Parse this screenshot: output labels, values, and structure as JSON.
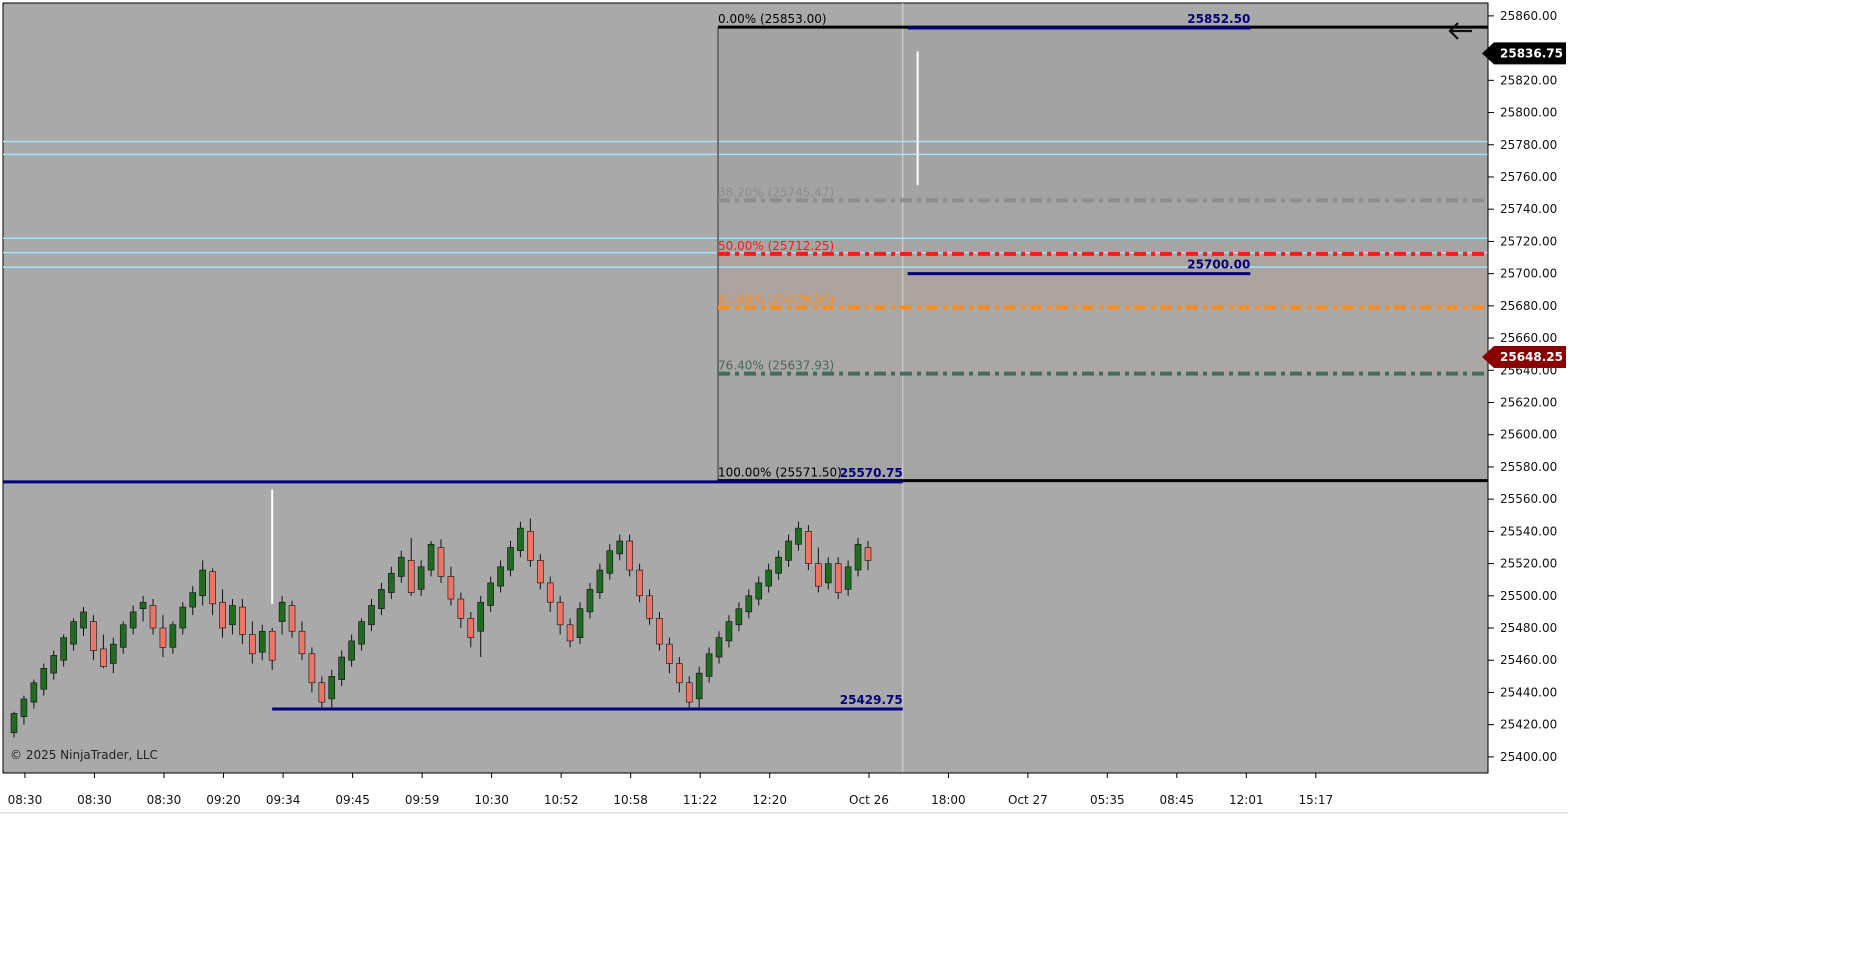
{
  "copyright": "© 2025 NinjaTrader, LLC",
  "colors": {
    "plot_bg": "#a9a9a9",
    "up": "#1f6b1f",
    "down": "#ee7466",
    "wick": "#111111",
    "navy": "#00007f",
    "fib_0": "#000000",
    "fib_382": "#8c8c8c",
    "fib_500": "#ff1a1a",
    "fib_618": "#ff8c1a",
    "fib_764": "#456a5e",
    "fib_100": "#000000",
    "zone_lines": "#9fe3ff",
    "last_price_bg": "#000000",
    "marker_price_bg": "#8b0000"
  },
  "chart_data": {
    "type": "candlestick",
    "y_axis": {
      "min": 25390,
      "max": 25868,
      "ticks": [
        25400,
        25420,
        25440,
        25460,
        25480,
        25500,
        25520,
        25540,
        25560,
        25580,
        25600,
        25620,
        25640,
        25660,
        25680,
        25700,
        25720,
        25740,
        25760,
        25780,
        25800,
        25820,
        25840,
        25860
      ],
      "tick_labels": [
        "25400.00",
        "25420.00",
        "25440.00",
        "25460.00",
        "25480.00",
        "25500.00",
        "25520.00",
        "25540.00",
        "25560.00",
        "25580.00",
        "25600.00",
        "25620.00",
        "25640.00",
        "25660.00",
        "25680.00",
        "25700.00",
        "25720.00",
        "25740.00",
        "25760.00",
        "25780.00",
        "25800.00",
        "25820.00",
        "25840.00",
        "25860.00"
      ]
    },
    "x_axis": {
      "labels": [
        "08:30",
        "08:30",
        "08:30",
        "09:20",
        "09:34",
        "09:45",
        "09:59",
        "10:30",
        "10:52",
        "10:58",
        "11:22",
        "12:20",
        "Oct 26",
        "18:00",
        "Oct 27",
        "05:35",
        "08:45",
        "12:01",
        "15:17"
      ],
      "label_index": [
        1,
        8,
        15,
        21,
        27,
        34,
        41,
        48,
        55,
        62,
        69,
        76,
        86,
        94,
        102,
        110,
        117,
        124,
        131
      ]
    },
    "price_markers": [
      {
        "label": "25836.75",
        "value": 25836.75,
        "role": "last"
      },
      {
        "label": "25648.25",
        "value": 25648.25,
        "role": "marker"
      }
    ],
    "fibonacci": {
      "start_index": 71,
      "end_index": 146,
      "levels": [
        {
          "label": "0.00% (25853.00)",
          "value": 25853.0,
          "color_key": "fib_0",
          "style": "solid"
        },
        {
          "label": "38.20% (25745.47)",
          "value": 25745.47,
          "color_key": "fib_382",
          "style": "dashdot"
        },
        {
          "label": "50.00% (25712.25)",
          "value": 25712.25,
          "color_key": "fib_500",
          "style": "dashdot"
        },
        {
          "label": "61.80% (25679.03)",
          "value": 25679.03,
          "color_key": "fib_618",
          "style": "dashdot"
        },
        {
          "label": "76.40% (25637.93)",
          "value": 25637.93,
          "color_key": "fib_764",
          "style": "dashdot"
        },
        {
          "label": "100.00% (25571.50)",
          "value": 25571.5,
          "color_key": "fib_100",
          "style": "solid"
        }
      ]
    },
    "swing_lines": [
      {
        "label": "25852.50",
        "value": 25852.5,
        "start_index": 90,
        "end_index": 124
      },
      {
        "label": "25700.00",
        "value": 25700.0,
        "start_index": 90,
        "end_index": 124
      },
      {
        "label": "25570.75",
        "value": 25570.75,
        "start_index": -1,
        "end_index": 89
      },
      {
        "label": "25429.75",
        "value": 25429.75,
        "start_index": 26,
        "end_index": 89
      }
    ],
    "zone_lines": [
      25782,
      25774,
      25722,
      25713,
      25704
    ],
    "candles": [
      {
        "o": 25415,
        "h": 25428,
        "l": 25412,
        "c": 25427
      },
      {
        "o": 25425,
        "h": 25438,
        "l": 25420,
        "c": 25436
      },
      {
        "o": 25434,
        "h": 25448,
        "l": 25430,
        "c": 25446
      },
      {
        "o": 25442,
        "h": 25458,
        "l": 25438,
        "c": 25455
      },
      {
        "o": 25452,
        "h": 25466,
        "l": 25448,
        "c": 25463
      },
      {
        "o": 25460,
        "h": 25476,
        "l": 25456,
        "c": 25474
      },
      {
        "o": 25470,
        "h": 25486,
        "l": 25466,
        "c": 25484
      },
      {
        "o": 25480,
        "h": 25493,
        "l": 25475,
        "c": 25490
      },
      {
        "o": 25484,
        "h": 25488,
        "l": 25460,
        "c": 25466
      },
      {
        "o": 25467,
        "h": 25476,
        "l": 25455,
        "c": 25456
      },
      {
        "o": 25458,
        "h": 25474,
        "l": 25452,
        "c": 25470
      },
      {
        "o": 25468,
        "h": 25484,
        "l": 25464,
        "c": 25482
      },
      {
        "o": 25480,
        "h": 25494,
        "l": 25476,
        "c": 25490
      },
      {
        "o": 25492,
        "h": 25500,
        "l": 25484,
        "c": 25496
      },
      {
        "o": 25494,
        "h": 25498,
        "l": 25476,
        "c": 25480
      },
      {
        "o": 25480,
        "h": 25488,
        "l": 25462,
        "c": 25468
      },
      {
        "o": 25468,
        "h": 25484,
        "l": 25464,
        "c": 25482
      },
      {
        "o": 25480,
        "h": 25496,
        "l": 25476,
        "c": 25493
      },
      {
        "o": 25493,
        "h": 25506,
        "l": 25488,
        "c": 25502
      },
      {
        "o": 25500,
        "h": 25522,
        "l": 25494,
        "c": 25516
      },
      {
        "o": 25515,
        "h": 25517,
        "l": 25488,
        "c": 25495
      },
      {
        "o": 25496,
        "h": 25504,
        "l": 25474,
        "c": 25480
      },
      {
        "o": 25482,
        "h": 25498,
        "l": 25476,
        "c": 25494
      },
      {
        "o": 25493,
        "h": 25498,
        "l": 25470,
        "c": 25476
      },
      {
        "o": 25476,
        "h": 25484,
        "l": 25458,
        "c": 25464
      },
      {
        "o": 25465,
        "h": 25482,
        "l": 25460,
        "c": 25478
      },
      {
        "o": 25478,
        "h": 25480,
        "l": 25454,
        "c": 25460
      },
      {
        "o": 25484,
        "h": 25500,
        "l": 25476,
        "c": 25496
      },
      {
        "o": 25494,
        "h": 25497,
        "l": 25474,
        "c": 25478
      },
      {
        "o": 25478,
        "h": 25484,
        "l": 25460,
        "c": 25464
      },
      {
        "o": 25464,
        "h": 25468,
        "l": 25440,
        "c": 25446
      },
      {
        "o": 25446,
        "h": 25450,
        "l": 25430,
        "c": 25434
      },
      {
        "o": 25436,
        "h": 25454,
        "l": 25430,
        "c": 25450
      },
      {
        "o": 25448,
        "h": 25466,
        "l": 25444,
        "c": 25462
      },
      {
        "o": 25460,
        "h": 25476,
        "l": 25456,
        "c": 25472
      },
      {
        "o": 25470,
        "h": 25486,
        "l": 25466,
        "c": 25484
      },
      {
        "o": 25482,
        "h": 25498,
        "l": 25478,
        "c": 25494
      },
      {
        "o": 25492,
        "h": 25508,
        "l": 25488,
        "c": 25504
      },
      {
        "o": 25502,
        "h": 25518,
        "l": 25498,
        "c": 25514
      },
      {
        "o": 25512,
        "h": 25528,
        "l": 25508,
        "c": 25524
      },
      {
        "o": 25522,
        "h": 25536,
        "l": 25500,
        "c": 25502
      },
      {
        "o": 25504,
        "h": 25522,
        "l": 25500,
        "c": 25518
      },
      {
        "o": 25516,
        "h": 25534,
        "l": 25512,
        "c": 25532
      },
      {
        "o": 25530,
        "h": 25535,
        "l": 25508,
        "c": 25512
      },
      {
        "o": 25512,
        "h": 25518,
        "l": 25494,
        "c": 25498
      },
      {
        "o": 25498,
        "h": 25502,
        "l": 25480,
        "c": 25486
      },
      {
        "o": 25486,
        "h": 25490,
        "l": 25468,
        "c": 25474
      },
      {
        "o": 25478,
        "h": 25500,
        "l": 25462,
        "c": 25496
      },
      {
        "o": 25494,
        "h": 25512,
        "l": 25490,
        "c": 25508
      },
      {
        "o": 25506,
        "h": 25522,
        "l": 25502,
        "c": 25518
      },
      {
        "o": 25516,
        "h": 25534,
        "l": 25512,
        "c": 25530
      },
      {
        "o": 25528,
        "h": 25546,
        "l": 25524,
        "c": 25542
      },
      {
        "o": 25540,
        "h": 25548,
        "l": 25518,
        "c": 25522
      },
      {
        "o": 25522,
        "h": 25526,
        "l": 25504,
        "c": 25508
      },
      {
        "o": 25508,
        "h": 25512,
        "l": 25490,
        "c": 25496
      },
      {
        "o": 25496,
        "h": 25500,
        "l": 25476,
        "c": 25482
      },
      {
        "o": 25482,
        "h": 25486,
        "l": 25468,
        "c": 25472
      },
      {
        "o": 25474,
        "h": 25496,
        "l": 25470,
        "c": 25492
      },
      {
        "o": 25490,
        "h": 25508,
        "l": 25486,
        "c": 25504
      },
      {
        "o": 25502,
        "h": 25520,
        "l": 25498,
        "c": 25516
      },
      {
        "o": 25514,
        "h": 25532,
        "l": 25510,
        "c": 25528
      },
      {
        "o": 25526,
        "h": 25538,
        "l": 25522,
        "c": 25534
      },
      {
        "o": 25534,
        "h": 25538,
        "l": 25512,
        "c": 25516
      },
      {
        "o": 25516,
        "h": 25520,
        "l": 25496,
        "c": 25500
      },
      {
        "o": 25500,
        "h": 25504,
        "l": 25482,
        "c": 25486
      },
      {
        "o": 25486,
        "h": 25490,
        "l": 25466,
        "c": 25470
      },
      {
        "o": 25470,
        "h": 25474,
        "l": 25452,
        "c": 25458
      },
      {
        "o": 25458,
        "h": 25462,
        "l": 25440,
        "c": 25446
      },
      {
        "o": 25446,
        "h": 25450,
        "l": 25430,
        "c": 25434
      },
      {
        "o": 25436,
        "h": 25456,
        "l": 25430,
        "c": 25452
      },
      {
        "o": 25450,
        "h": 25468,
        "l": 25446,
        "c": 25464
      },
      {
        "o": 25462,
        "h": 25478,
        "l": 25458,
        "c": 25474
      },
      {
        "o": 25472,
        "h": 25488,
        "l": 25468,
        "c": 25484
      },
      {
        "o": 25482,
        "h": 25496,
        "l": 25478,
        "c": 25492
      },
      {
        "o": 25490,
        "h": 25504,
        "l": 25486,
        "c": 25500
      },
      {
        "o": 25498,
        "h": 25512,
        "l": 25494,
        "c": 25508
      },
      {
        "o": 25506,
        "h": 25520,
        "l": 25502,
        "c": 25516
      },
      {
        "o": 25514,
        "h": 25528,
        "l": 25510,
        "c": 25524
      },
      {
        "o": 25522,
        "h": 25538,
        "l": 25518,
        "c": 25534
      },
      {
        "o": 25532,
        "h": 25546,
        "l": 25528,
        "c": 25542
      },
      {
        "o": 25540,
        "h": 25544,
        "l": 25516,
        "c": 25520
      },
      {
        "o": 25520,
        "h": 25530,
        "l": 25502,
        "c": 25506
      },
      {
        "o": 25508,
        "h": 25524,
        "l": 25504,
        "c": 25520
      },
      {
        "o": 25520,
        "h": 25524,
        "l": 25498,
        "c": 25502
      },
      {
        "o": 25504,
        "h": 25522,
        "l": 25500,
        "c": 25518
      },
      {
        "o": 25516,
        "h": 25536,
        "l": 25512,
        "c": 25532
      },
      {
        "o": 25530,
        "h": 25534,
        "l": 25516,
        "c": 25522
      }
    ]
  }
}
